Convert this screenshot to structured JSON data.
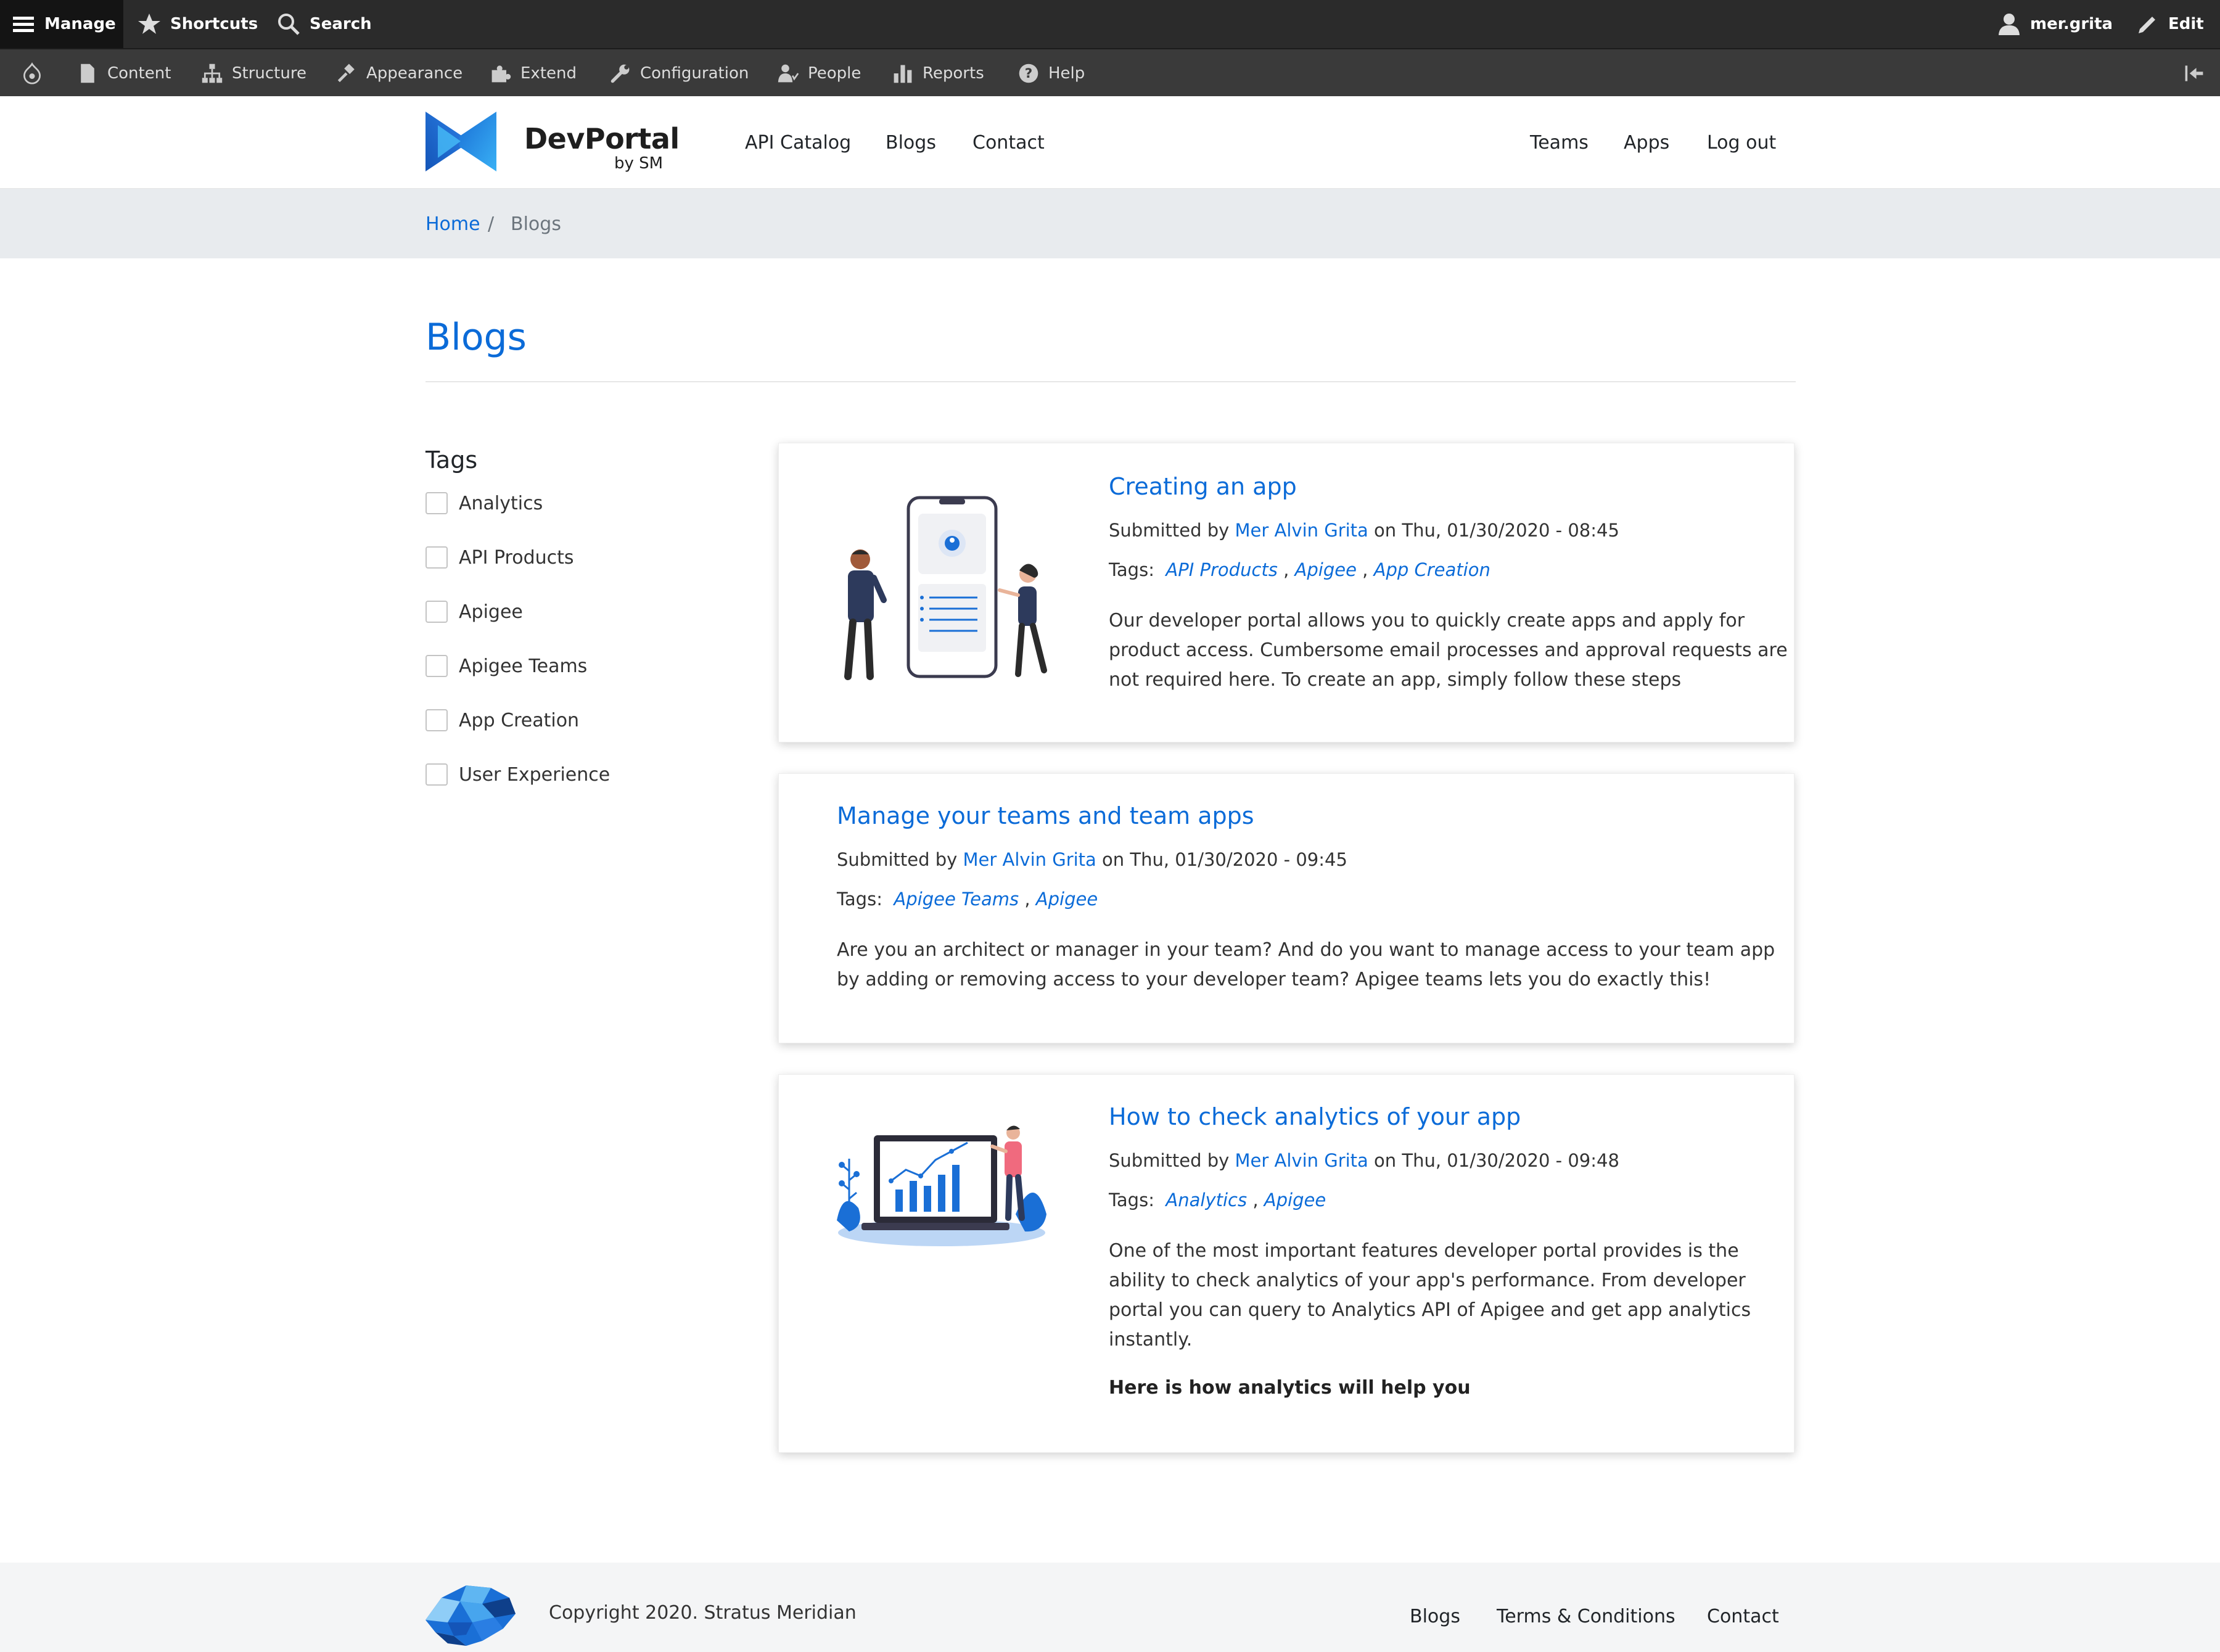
{
  "toolbar": {
    "manage": "Manage",
    "shortcuts": "Shortcuts",
    "search": "Search",
    "user": "mer.grita",
    "edit": "Edit"
  },
  "admin_menu": {
    "content": "Content",
    "structure": "Structure",
    "appearance": "Appearance",
    "extend": "Extend",
    "configuration": "Configuration",
    "people": "People",
    "reports": "Reports",
    "help": "Help"
  },
  "brand": {
    "title": "DevPortal",
    "subtitle": "by SM"
  },
  "nav": {
    "api_catalog": "API Catalog",
    "blogs": "Blogs",
    "contact": "Contact",
    "teams": "Teams",
    "apps": "Apps",
    "logout": "Log out"
  },
  "breadcrumb": {
    "home": "Home",
    "separator": "/",
    "current": "Blogs"
  },
  "page": {
    "title": "Blogs"
  },
  "tags": {
    "heading": "Tags",
    "items": [
      "Analytics",
      "API Products",
      "Apigee",
      "Apigee Teams",
      "App Creation",
      "User Experience"
    ]
  },
  "posts": [
    {
      "title": "Creating an app",
      "submitted_by": "Submitted by",
      "author": "Mer Alvin Grita",
      "date": "on Thu, 01/30/2020 - 08:45",
      "tags_label": "Tags:",
      "tags": [
        "API Products",
        "Apigee",
        "App Creation"
      ],
      "body_lines": [
        "Our developer portal allows you to quickly create apps and apply for",
        "product access. Cumbersome email processes and approval requests are",
        "not required here. To create an app, simply follow these steps"
      ]
    },
    {
      "title": "Manage your teams and team apps",
      "submitted_by": "Submitted by",
      "author": "Mer Alvin Grita",
      "date": "on Thu, 01/30/2020 - 09:45",
      "tags_label": "Tags:",
      "tags": [
        "Apigee Teams",
        "Apigee"
      ],
      "body_lines": [
        "Are you an architect or manager in your team? And do you want to manage access to your team app",
        "by adding or removing access to your developer team? Apigee teams lets you do exactly this!"
      ]
    },
    {
      "title": "How to check analytics of your app",
      "submitted_by": "Submitted by",
      "author": "Mer Alvin Grita",
      "date": "on Thu, 01/30/2020 - 09:48",
      "tags_label": "Tags:",
      "tags": [
        "Analytics",
        "Apigee"
      ],
      "body_lines": [
        "One of the most important features developer portal provides is the",
        "ability to check analytics of your app's performance. From developer",
        "portal you can query to Analytics API of Apigee and get app analytics",
        "instantly."
      ],
      "subheading": "Here is how analytics will help you"
    }
  ],
  "footer": {
    "copyright": "Copyright 2020. Stratus Meridian",
    "blogs": "Blogs",
    "terms": "Terms & Conditions",
    "contact": "Contact"
  },
  "colors": {
    "accent": "#0b6bd8",
    "toolbar": "#2b2b2b",
    "toolbar_secondary": "#3a3a3a",
    "breadcrumb_bg": "#e8ebee"
  }
}
